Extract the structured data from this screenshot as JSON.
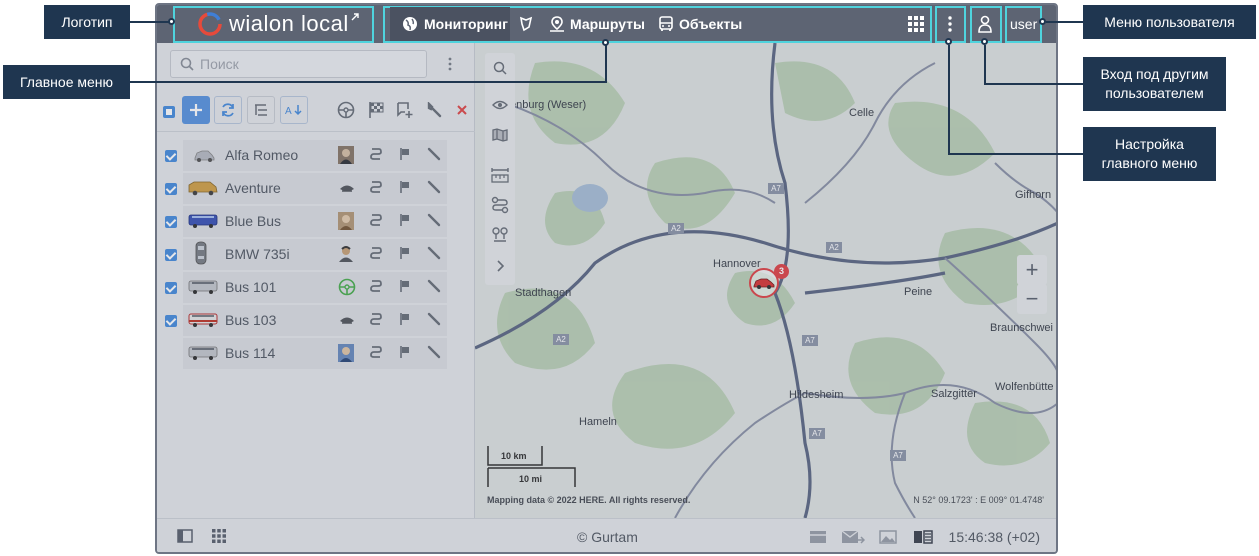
{
  "callouts": {
    "logo": "Логотип",
    "main_menu": "Главное меню",
    "user_menu": "Меню пользователя",
    "login_as": "Вход под другим пользователем",
    "menu_settings": "Настройка главного меню"
  },
  "header": {
    "brand": "wialon local",
    "tabs": [
      {
        "label": "Мониторинг",
        "icon": "globe-icon"
      },
      {
        "label": "",
        "icon": "geofence-icon"
      },
      {
        "label": "Маршруты",
        "icon": "routes-icon"
      },
      {
        "label": "Объекты",
        "icon": "bus-icon"
      }
    ],
    "user": "user"
  },
  "search": {
    "placeholder": "Поиск"
  },
  "units": [
    {
      "name": "Alfa Romeo",
      "checked": true,
      "driver_icon": "driver-photo-icon"
    },
    {
      "name": "Aventure",
      "checked": true,
      "driver_icon": "driver-avatar-icon"
    },
    {
      "name": "Blue Bus",
      "checked": true,
      "driver_icon": "driver-photo-icon"
    },
    {
      "name": "BMW 735i",
      "checked": true,
      "driver_icon": "driver-avatar-icon"
    },
    {
      "name": "Bus 101",
      "checked": true,
      "driver_icon": "steering-wheel-icon"
    },
    {
      "name": "Bus 103",
      "checked": true,
      "driver_icon": "driver-avatar-icon"
    },
    {
      "name": "Bus 114",
      "checked": false,
      "driver_icon": "driver-photo-icon"
    }
  ],
  "map": {
    "cities": [
      {
        "name": "enburg (Weser)"
      },
      {
        "name": "Celle"
      },
      {
        "name": "Gifhorn"
      },
      {
        "name": "Hannover"
      },
      {
        "name": "Stadthagen"
      },
      {
        "name": "Peine"
      },
      {
        "name": "Braunschwei"
      },
      {
        "name": "Hildesheim"
      },
      {
        "name": "Salzgitter"
      },
      {
        "name": "Wolfenbütte"
      },
      {
        "name": "Hameln"
      }
    ],
    "roads": [
      "A7",
      "A2",
      "A2",
      "A7",
      "A7",
      "A7",
      "A2"
    ],
    "cluster_count": "3",
    "scale_km": "10 km",
    "scale_mi": "10 mi",
    "attribution": "Mapping data © 2022 HERE. All rights reserved.",
    "coords": "N 52° 09.1723' : E 009° 01.4748'",
    "zoom_in": "+",
    "zoom_out": "−"
  },
  "footer": {
    "copyright": "© Gurtam",
    "clock": "15:46:38 (+02)"
  },
  "colors": {
    "header_bg": "#5d6473",
    "highlight": "#4fd3dd",
    "callout_bg": "#1f3650",
    "accent": "#4a8ede"
  }
}
